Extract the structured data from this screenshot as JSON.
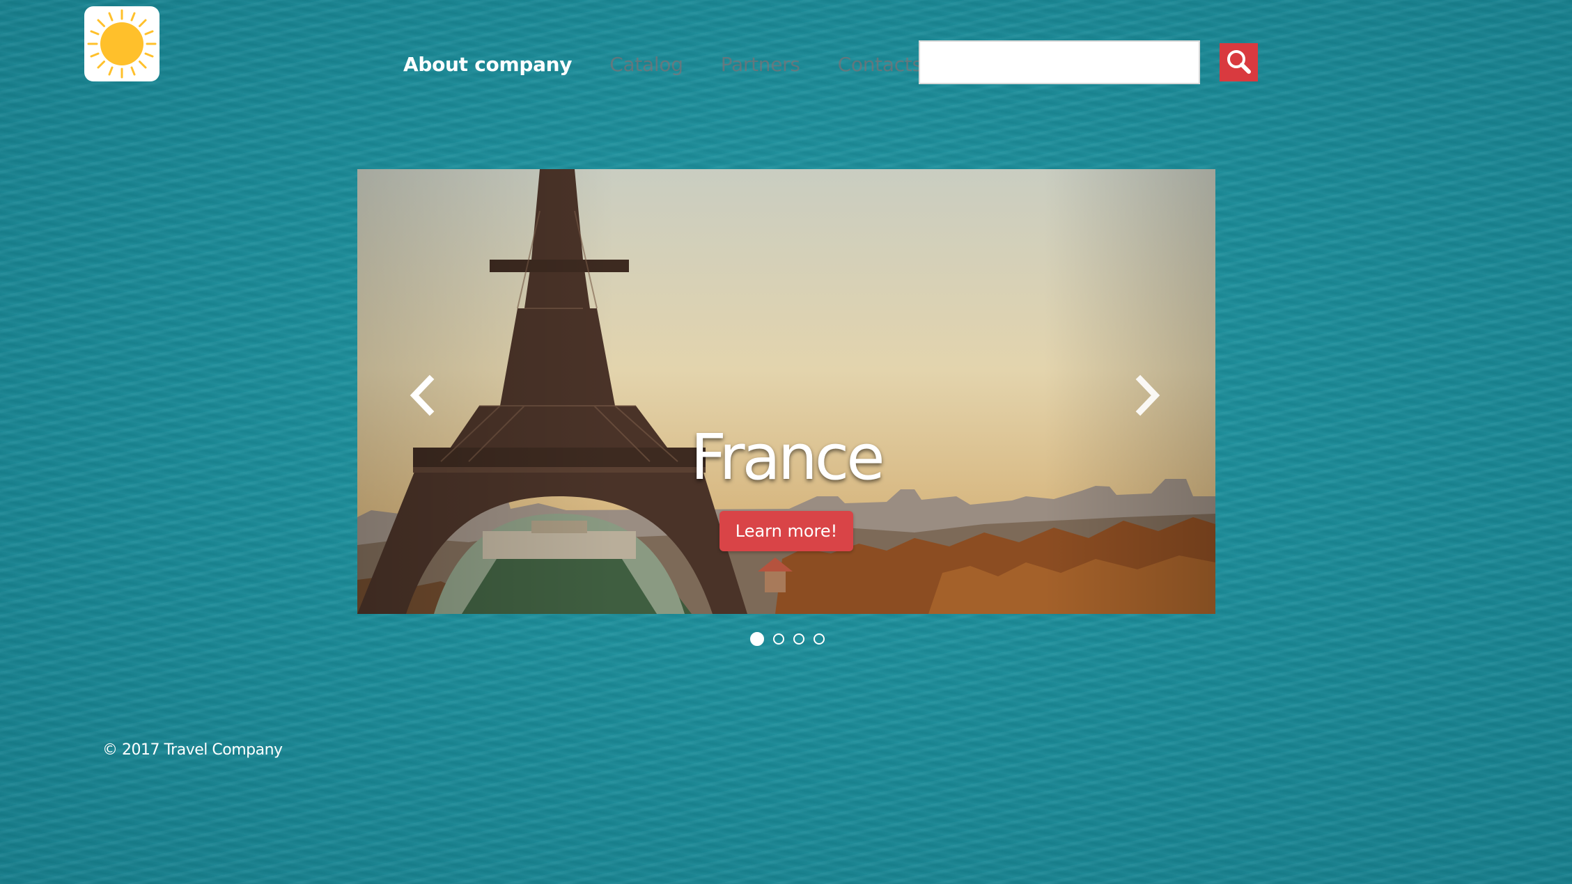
{
  "header": {
    "logo_icon": "sun-icon",
    "nav": [
      {
        "label": "About company",
        "active": true
      },
      {
        "label": "Catalog",
        "active": false
      },
      {
        "label": "Partners",
        "active": false
      },
      {
        "label": "Contacts",
        "active": false
      }
    ],
    "search": {
      "value": "",
      "placeholder": "",
      "button_icon": "search-icon"
    }
  },
  "carousel": {
    "slide_title": "France",
    "button_label": "Learn more!",
    "prev_icon": "chevron-left-icon",
    "next_icon": "chevron-right-icon",
    "slide_count": 4,
    "active_slide": 1
  },
  "footer": {
    "copyright": "© 2017 Travel Company"
  },
  "colors": {
    "background": "#1e8f9c",
    "accent": "#d93a3f",
    "logo_sun": "#ffc02b",
    "nav_active": "#ffffff",
    "nav_inactive": "#8e6d6f"
  }
}
